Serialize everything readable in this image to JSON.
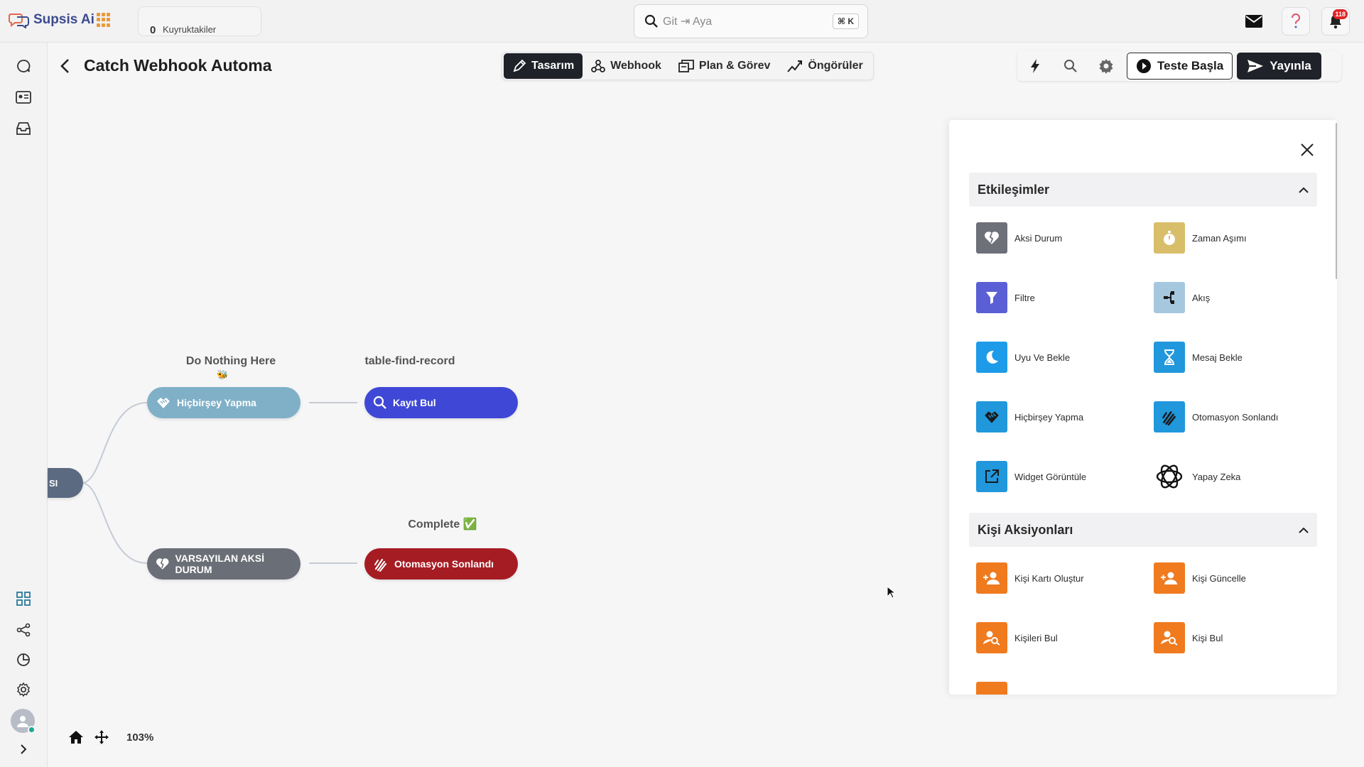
{
  "app": {
    "name": "Supsis Ai"
  },
  "queue": {
    "count": "0",
    "label": "Kuyruktakiler"
  },
  "search": {
    "placeholder": "Git ⇥ Aya",
    "value": "",
    "shortcut": "⌘ K"
  },
  "notifications": {
    "count": "118"
  },
  "header": {
    "title": "Catch Webhook Automa",
    "tabs": [
      {
        "label": "Tasarım",
        "active": true,
        "icon": "design-icon"
      },
      {
        "label": "Webhook",
        "active": false,
        "icon": "webhook-icon"
      },
      {
        "label": "Plan & Görev",
        "active": false,
        "icon": "tasks-icon"
      },
      {
        "label": "Öngörüler",
        "active": false,
        "icon": "insights-icon"
      }
    ],
    "test_label": "Teste Başla",
    "publish_label": "Yayınla"
  },
  "flow": {
    "root_label": "SI",
    "branches": [
      {
        "first": {
          "caption": "Do Nothing Here",
          "emoji": "🐝",
          "label": "Hiçbirşey Yapma",
          "color": "#7fb0c8",
          "icon": "handshake-icon"
        },
        "second": {
          "caption": "table-find-record",
          "label": "Kayıt Bul",
          "color": "#3f48d6",
          "icon": "search-icon"
        }
      },
      {
        "first": {
          "caption": "",
          "label": "VARSAYILAN AKSİ DURUM",
          "color": "#6a6e76",
          "icon": "broken-heart-icon"
        },
        "second": {
          "caption": "Complete ✅",
          "label": "Otomasyon Sonlandı",
          "color": "#a61c23",
          "icon": "clap-icon"
        }
      }
    ]
  },
  "canvas": {
    "zoom": "103%"
  },
  "panel": {
    "sections": [
      {
        "title": "Etkileşimler",
        "items": [
          {
            "label": "Aksi Durum",
            "icon": "broken-heart-icon",
            "color": "#6e7079"
          },
          {
            "label": "Zaman Aşımı",
            "icon": "stopwatch-icon",
            "color": "#d9be6a"
          },
          {
            "label": "Filtre",
            "icon": "filter-icon",
            "color": "#5a5fd6"
          },
          {
            "label": "Akış",
            "icon": "flow-icon",
            "color": "#a5c8df"
          },
          {
            "label": "Uyu Ve Bekle",
            "icon": "moon-icon",
            "color": "#1d9be8"
          },
          {
            "label": "Mesaj Bekle",
            "icon": "hourglass-icon",
            "color": "#2197dc"
          },
          {
            "label": "Hiçbirşey Yapma",
            "icon": "handshake-icon",
            "color": "#2197dc"
          },
          {
            "label": "Otomasyon Sonlandı",
            "icon": "clap-icon",
            "color": "#2197dc"
          },
          {
            "label": "Widget Görüntüle",
            "icon": "external-link-icon",
            "color": "#2197dc"
          },
          {
            "label": "Yapay Zeka",
            "icon": "openai-icon",
            "color": ""
          }
        ]
      },
      {
        "title": "Kişi Aksiyonları",
        "items": [
          {
            "label": "Kişi Kartı Oluştur",
            "icon": "user-add-icon",
            "color": "#f07a1e"
          },
          {
            "label": "Kişi Güncelle",
            "icon": "user-edit-icon",
            "color": "#f07a1e"
          },
          {
            "label": "Kişileri Bul",
            "icon": "user-search-icon",
            "color": "#f07a1e"
          },
          {
            "label": "Kişi Bul",
            "icon": "user-search-icon",
            "color": "#f07a1e"
          }
        ]
      }
    ]
  }
}
